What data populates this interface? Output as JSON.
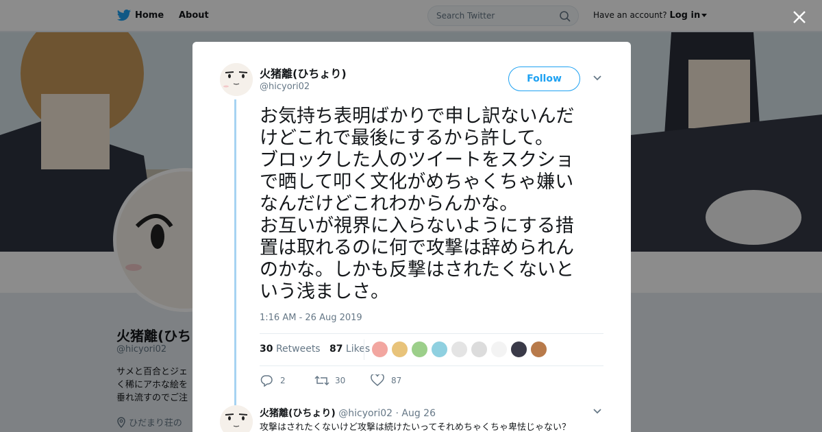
{
  "nav": {
    "home_label": "Home",
    "about_label": "About",
    "search_placeholder": "Search Twitter",
    "account_prompt": "Have an account?",
    "login_label": "Log in"
  },
  "profile": {
    "name": "火猪離(ひち",
    "handle": "@hicyori02",
    "bio_lines": [
      "サメと百合とジェ",
      "く稀にアホな絵を",
      "垂れ流すのでご注"
    ],
    "location": "ひだまり荘の"
  },
  "tweet": {
    "author_name": "火猪離(ひちょり)",
    "author_handle": "@hicyori02",
    "follow_label": "Follow",
    "text": "お気持ち表明ばかりで申し訳ないんだけどこれで最後にするから許して。\nブロックした人のツイートをスクショで晒して叩く文化がめちゃくちゃ嫌いなんだけどこれわからんかな。\nお互いが視界に入らないようにする措置は取れるのに何で攻撃は辞められんのかな。しかも反撃はされたくないという浅ましさ。",
    "timestamp": "1:16 AM - 26 Aug 2019",
    "retweets_count": "30",
    "retweets_label": "Retweets",
    "likes_count": "87",
    "likes_label": "Likes",
    "reply_action_count": "2",
    "retweet_action_count": "30",
    "like_action_count": "87",
    "liker_colors": [
      "#f2a6a0",
      "#e8c37a",
      "#9ccf8a",
      "#8fd0e0",
      "#e4e4e4",
      "#dcdcdc",
      "#f3f3f3",
      "#3a3a48",
      "#b87a4a"
    ]
  },
  "reply": {
    "author_name": "火猪離(ひちょり)",
    "author_handle": "@hicyori02",
    "date": "· Aug 26",
    "text": "攻撃はされたくないけど攻撃は続けたいってそれめちゃくちゃ卑怯じゃない？"
  }
}
